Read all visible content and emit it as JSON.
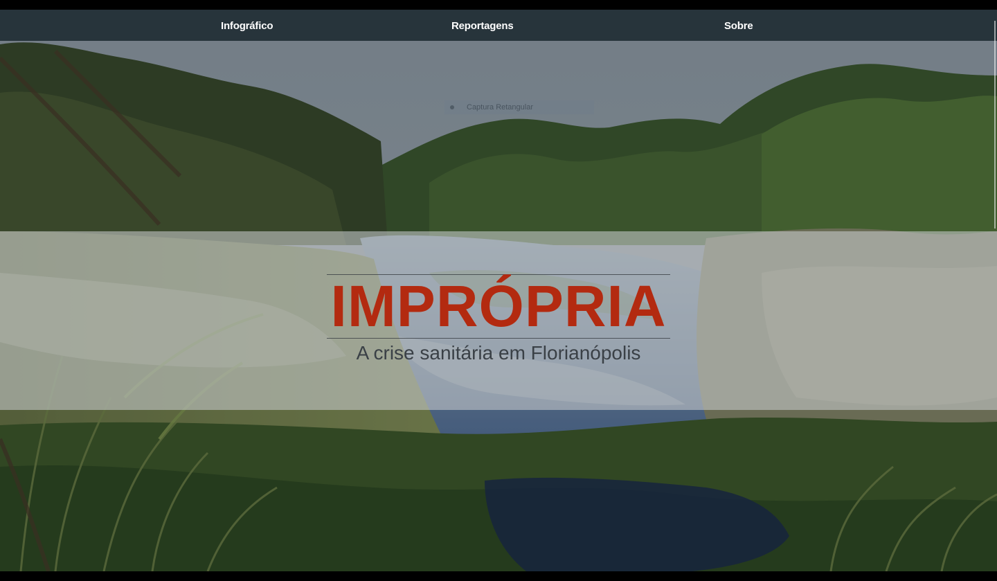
{
  "nav": {
    "items": [
      {
        "label": "Infográfico"
      },
      {
        "label": "Reportagens"
      },
      {
        "label": "Sobre"
      }
    ],
    "background": "#27343b"
  },
  "hero": {
    "title": "IMPRÓPRIA",
    "subtitle": "A crise sanitária em Florianópolis",
    "title_color": "#b32a10",
    "subtitle_color": "#3a4046",
    "photo_icon": "creek-landscape-photo"
  },
  "ghost_overlay": {
    "label": "Captura Retangular"
  }
}
